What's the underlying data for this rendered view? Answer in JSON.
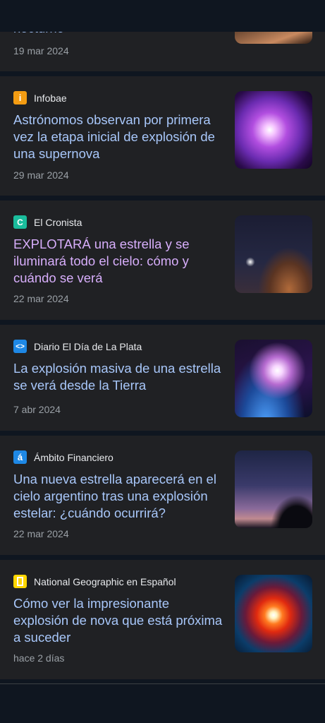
{
  "articles": [
    {
      "source": "",
      "title": "nocturno",
      "date": "19 mar 2024"
    },
    {
      "source": "Infobae",
      "source_icon": "infobae-icon",
      "title": "Astrónomos observan por primera vez la etapa inicial de explosión de una supernova",
      "date": "29 mar 2024",
      "icon_color": "#f39c12"
    },
    {
      "source": "El Cronista",
      "source_icon": "el-cronista-icon",
      "title": "EXPLOTARÁ una estrella y se iluminará todo el cielo: cómo y cuándo se verá",
      "date": "22 mar 2024",
      "icon_color": "#1abc9c"
    },
    {
      "source": "Diario El Día de La Plata",
      "source_icon": "diario-el-dia-icon",
      "title": "La explosión masiva de una estrella se verá desde la Tierra",
      "date": "7 abr 2024",
      "icon_color": "#1e88e5"
    },
    {
      "source": "Ámbito Financiero",
      "source_icon": "ambito-icon",
      "title": "Una nueva estrella aparecerá en el cielo argentino tras una explosión estelar: ¿cuándo ocurrirá?",
      "date": "22 mar 2024",
      "icon_color": "#1e88e5"
    },
    {
      "source": "National Geographic en Español",
      "source_icon": "natgeo-icon",
      "title": "Cómo ver la impresionante explosión de nova que está próxima a suceder",
      "date": "hace 2 días",
      "icon_color": "#ffd600"
    }
  ]
}
